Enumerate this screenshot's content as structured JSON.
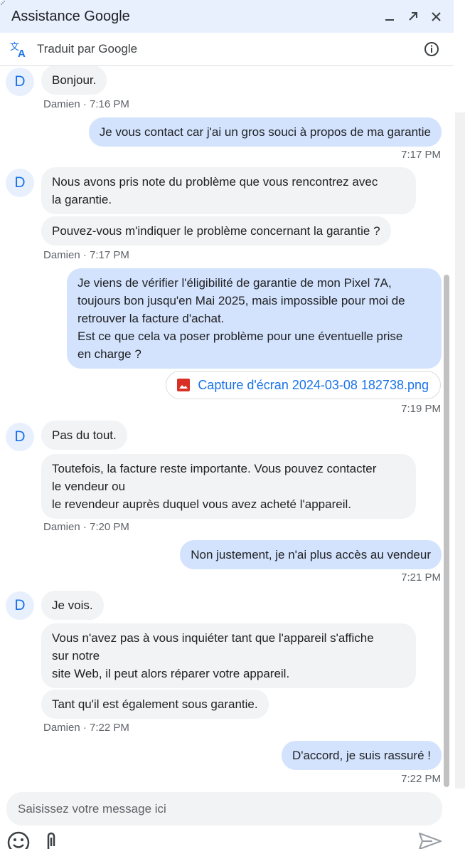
{
  "window": {
    "title": "Assistance Google",
    "minimize_icon": "minimize-icon",
    "popout_icon": "open-in-new-icon",
    "close_icon": "close-icon"
  },
  "translation": {
    "label": "Traduit par Google",
    "icon": "translate-icon",
    "info_icon": "info-icon"
  },
  "messages": [
    {
      "avatar": "D",
      "text": "Bonjour."
    },
    {
      "meta": "Damien · 7:16 PM"
    },
    {
      "text": "Je vous contact car j'ai un gros souci à propos de ma garantie"
    },
    {
      "meta": "7:17 PM"
    },
    {
      "avatar": "D",
      "text_lines": [
        "Nous avons pris note du problème que vous rencontrez avec",
        "la garantie."
      ]
    },
    {
      "text": "Pouvez-vous m'indiquer le problème concernant la garantie ?"
    },
    {
      "meta": "Damien · 7:17 PM"
    },
    {
      "text_lines": [
        "Je viens de vérifier l'éligibilité de garantie de mon Pixel 7A,",
        "toujours bon jusqu'en Mai 2025, mais impossible pour moi de",
        "retrouver la facture d'achat.",
        "Est ce que cela va poser problème pour une éventuelle prise",
        "en charge ?"
      ]
    },
    {
      "attachment": "Capture d'écran 2024-03-08 182738.png"
    },
    {
      "meta": "7:19 PM"
    },
    {
      "avatar": "D",
      "text": "Pas du tout."
    },
    {
      "text_lines": [
        "Toutefois, la facture reste importante. Vous pouvez contacter",
        "le vendeur ou",
        "le revendeur auprès duquel vous avez acheté l'appareil."
      ]
    },
    {
      "meta": "Damien · 7:20 PM"
    },
    {
      "text": "Non justement, je n'ai plus accès au vendeur"
    },
    {
      "meta": "7:21 PM"
    },
    {
      "avatar": "D",
      "text": "Je vois."
    },
    {
      "text_lines": [
        "Vous n'avez pas à vous inquiéter tant que l'appareil s'affiche",
        "sur notre",
        "site Web, il peut alors réparer votre appareil."
      ]
    },
    {
      "text": "Tant qu'il est également sous garantie."
    },
    {
      "meta": "Damien · 7:22 PM"
    },
    {
      "text": "D'accord, je suis rassuré !"
    },
    {
      "meta": "7:22 PM"
    }
  ],
  "composer": {
    "placeholder": "Saisissez votre message ici",
    "emoji_icon": "emoji-icon",
    "attach_icon": "paperclip-icon",
    "send_icon": "send-icon"
  },
  "colors": {
    "header_bg": "#e8f0fe",
    "outgoing_bubble": "#d3e3fd",
    "incoming_bubble": "#f1f3f4",
    "accent": "#1a73e8",
    "attachment_icon": "#d93025"
  }
}
